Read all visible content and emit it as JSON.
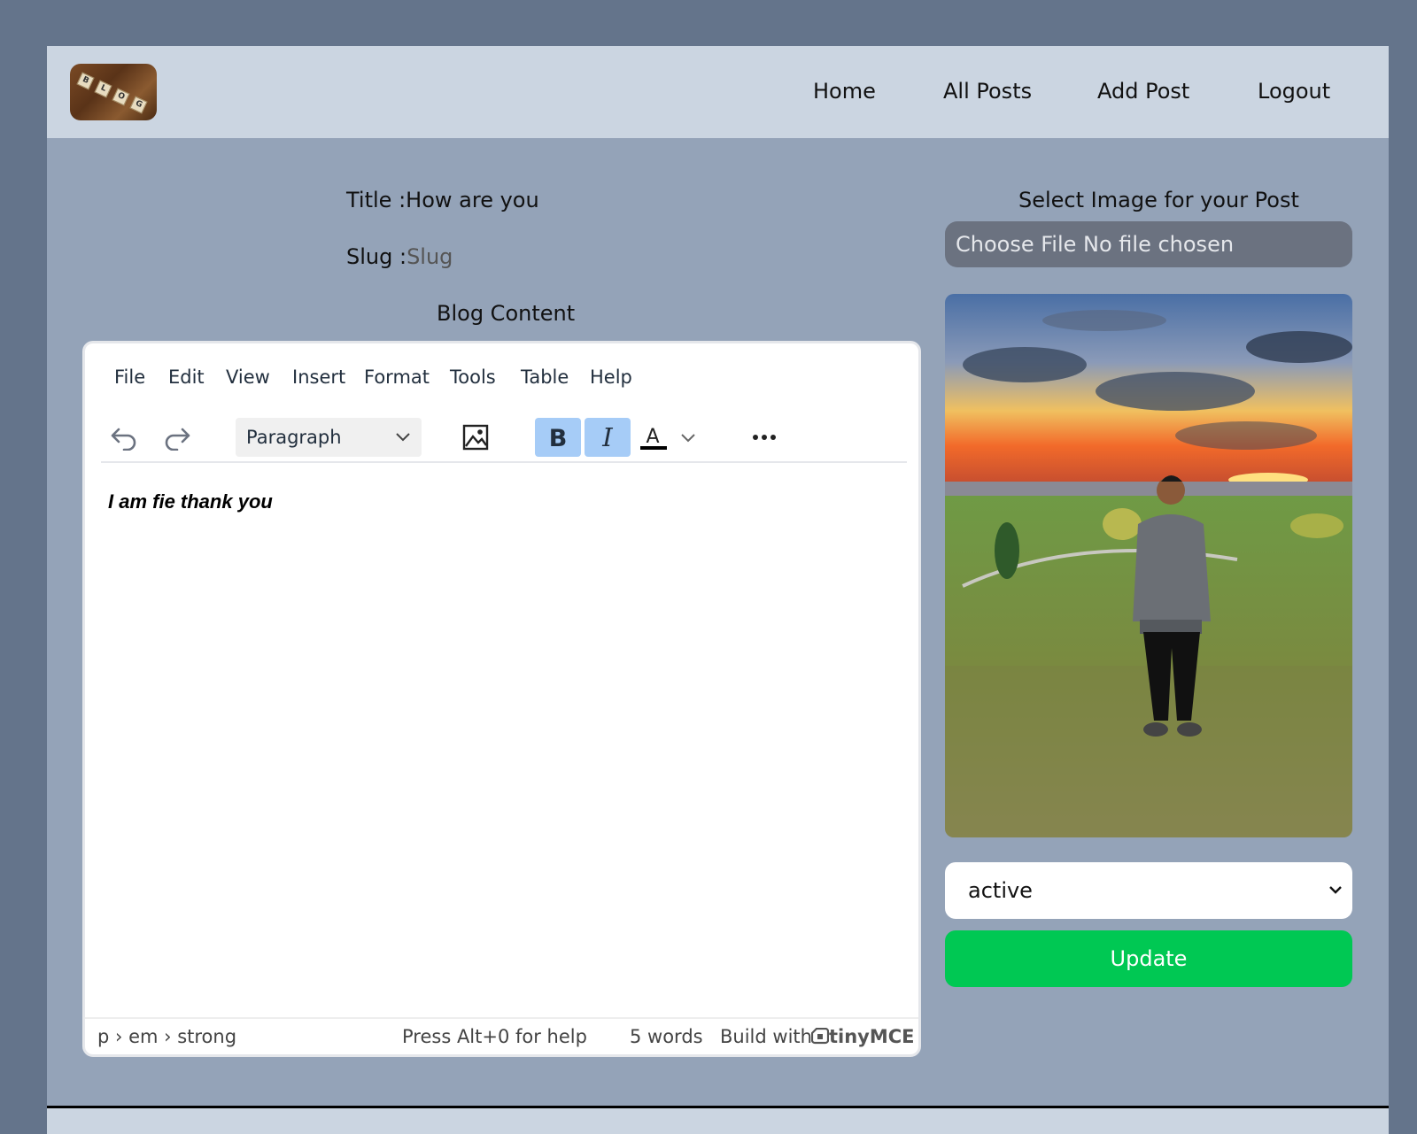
{
  "nav": {
    "items": [
      {
        "label": "Home"
      },
      {
        "label": "All Posts"
      },
      {
        "label": "Add Post"
      },
      {
        "label": "Logout"
      }
    ],
    "logo_tiles": [
      "B",
      "L",
      "O",
      "G"
    ]
  },
  "form": {
    "title_label": "Title :",
    "title_value": "How are you",
    "slug_label": "Slug :",
    "slug_placeholder": "Slug",
    "content_label": "Blog Content"
  },
  "editor": {
    "menu": [
      "File",
      "Edit",
      "View",
      "Insert",
      "Format",
      "Tools",
      "Table",
      "Help"
    ],
    "block_format": "Paragraph",
    "content_text": "I am fie thank you",
    "status": {
      "path": "p › em › strong",
      "help": "Press Alt+0 for help",
      "word_count": "5 words",
      "build_with": "Build with",
      "brand": "tinyMCE"
    }
  },
  "image_panel": {
    "label": "Select Image for your Post",
    "file_input_text": "Choose File No file chosen"
  },
  "status_select": {
    "value": "active"
  },
  "update_label": "Update",
  "colors": {
    "page_bg": "#64748b",
    "container_bg": "#94a3b8",
    "header_bg": "#cbd5e1",
    "update_button": "#00c853",
    "toolbar_active": "#a6ccf7"
  },
  "icons": [
    "undo-icon",
    "redo-icon",
    "image-icon",
    "bold-icon",
    "italic-icon",
    "text-color-icon",
    "more-icon",
    "chevron-down-icon"
  ]
}
